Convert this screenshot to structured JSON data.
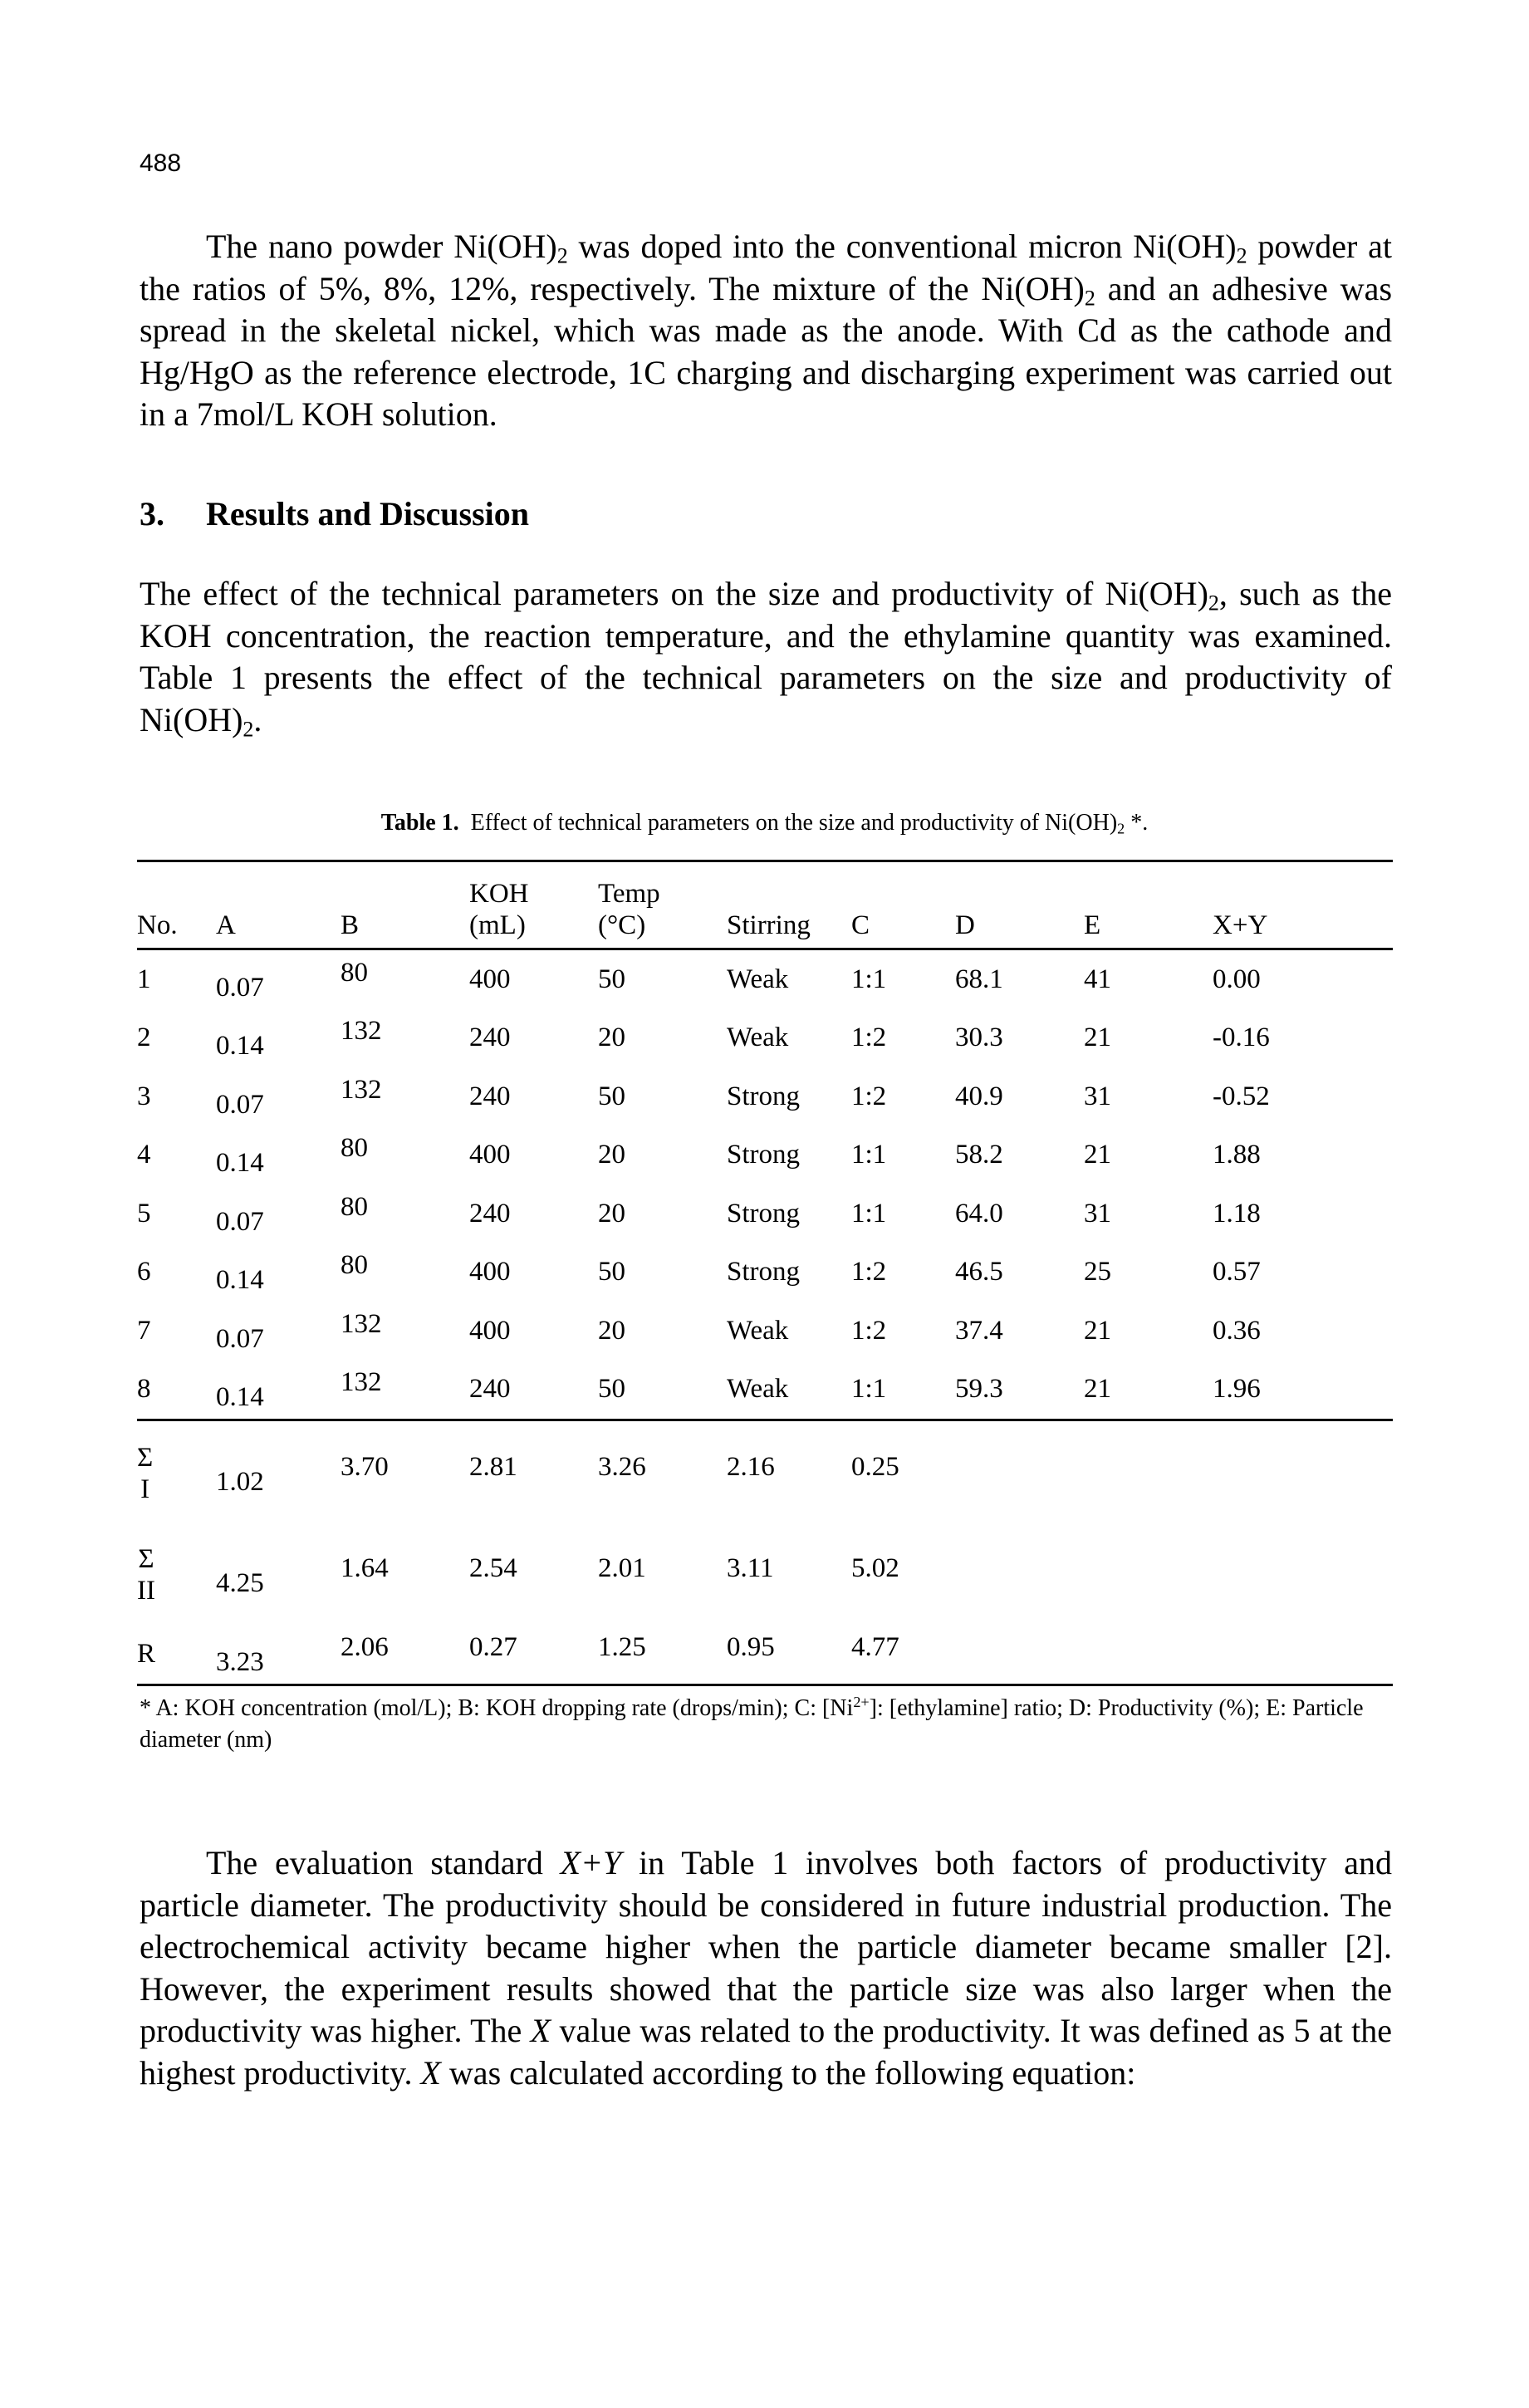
{
  "page_number": "488",
  "paragraph1": {
    "parts": [
      "The nano powder Ni(OH)",
      "2",
      " was doped into the conventional micron Ni(OH)",
      "2",
      " powder at the ratios of 5%, 8%, 12%, respectively. The mixture of the Ni(OH)",
      "2",
      " and an adhesive was spread in the skeletal nickel, which was made as the anode. With Cd as the cathode and Hg/HgO as the reference electrode, 1C charging and discharging experiment was carried out in a 7mol/L KOH solution."
    ]
  },
  "section": {
    "number": "3.",
    "title": "Results and Discussion"
  },
  "paragraph2": {
    "parts": [
      "The effect of the technical parameters on the size and productivity of Ni(OH)",
      "2",
      ", such as the KOH concentration, the reaction temperature, and the ethylamine quantity was examined. Table 1 presents the effect of the technical parameters on the size and productivity of Ni(OH)",
      "2",
      "."
    ]
  },
  "table": {
    "caption_label": "Table 1.",
    "caption_text": "Effect of technical parameters on the size and productivity of Ni(OH)",
    "caption_sub": "2",
    "caption_tail": " *.",
    "headers": [
      {
        "top": "",
        "bottom": "No."
      },
      {
        "top": "",
        "bottom": "A"
      },
      {
        "top": "",
        "bottom": "B"
      },
      {
        "top": "KOH",
        "bottom": "(mL)"
      },
      {
        "top": "Temp",
        "bottom": "(°C)"
      },
      {
        "top": "",
        "bottom": "Stirring"
      },
      {
        "top": "",
        "bottom": "C"
      },
      {
        "top": "",
        "bottom": "D"
      },
      {
        "top": "",
        "bottom": "E"
      },
      {
        "top": "",
        "bottom": "X+Y"
      }
    ],
    "rows": [
      [
        "1",
        "0.07",
        "80",
        "400",
        "50",
        "Weak",
        "1:1",
        "68.1",
        "41",
        "0.00"
      ],
      [
        "2",
        "0.14",
        "132",
        "240",
        "20",
        "Weak",
        "1:2",
        "30.3",
        "21",
        "-0.16"
      ],
      [
        "3",
        "0.07",
        "132",
        "240",
        "50",
        "Strong",
        "1:2",
        "40.9",
        "31",
        "-0.52"
      ],
      [
        "4",
        "0.14",
        "80",
        "400",
        "20",
        "Strong",
        "1:1",
        "58.2",
        "21",
        "1.88"
      ],
      [
        "5",
        "0.07",
        "80",
        "240",
        "20",
        "Strong",
        "1:1",
        "64.0",
        "31",
        "1.18"
      ],
      [
        "6",
        "0.14",
        "80",
        "400",
        "50",
        "Strong",
        "1:2",
        "46.5",
        "25",
        "0.57"
      ],
      [
        "7",
        "0.07",
        "132",
        "400",
        "20",
        "Weak",
        "1:2",
        "37.4",
        "21",
        "0.36"
      ],
      [
        "8",
        "0.14",
        "132",
        "240",
        "50",
        "Weak",
        "1:1",
        "59.3",
        "21",
        "1.96"
      ]
    ],
    "summary_rows": [
      {
        "label_top": "Σ",
        "label_bottom": "I",
        "values": [
          "1.02",
          "3.70",
          "2.81",
          "3.26",
          "2.16",
          "0.25"
        ]
      },
      {
        "label_top": "Σ",
        "label_bottom": "II",
        "values": [
          "4.25",
          "1.64",
          "2.54",
          "2.01",
          "3.11",
          "5.02"
        ]
      },
      {
        "label_top": "R",
        "label_bottom": "",
        "values": [
          "3.23",
          "2.06",
          "0.27",
          "1.25",
          "0.95",
          "4.77"
        ]
      }
    ],
    "footnote_a": "* A: KOH concentration (mol/L); B: KOH dropping rate (drops/min); C: [Ni",
    "footnote_sup": "2+",
    "footnote_b": "]: [ethylamine] ratio; D: Productivity (%); E: Particle diameter (nm)"
  },
  "paragraph3": {
    "parts": [
      "The evaluation standard ",
      "X+Y",
      " in Table 1 involves both factors of productivity and particle diameter. The productivity should be considered in future industrial production. The electrochemical activity became higher when the particle diameter became smaller [2]. However, the experiment results showed that the particle size was also larger when the productivity was higher. The ",
      "X",
      " value was related to the productivity. It was defined as 5 at the highest productivity. ",
      "X",
      " was calculated according to the following equation:"
    ]
  }
}
